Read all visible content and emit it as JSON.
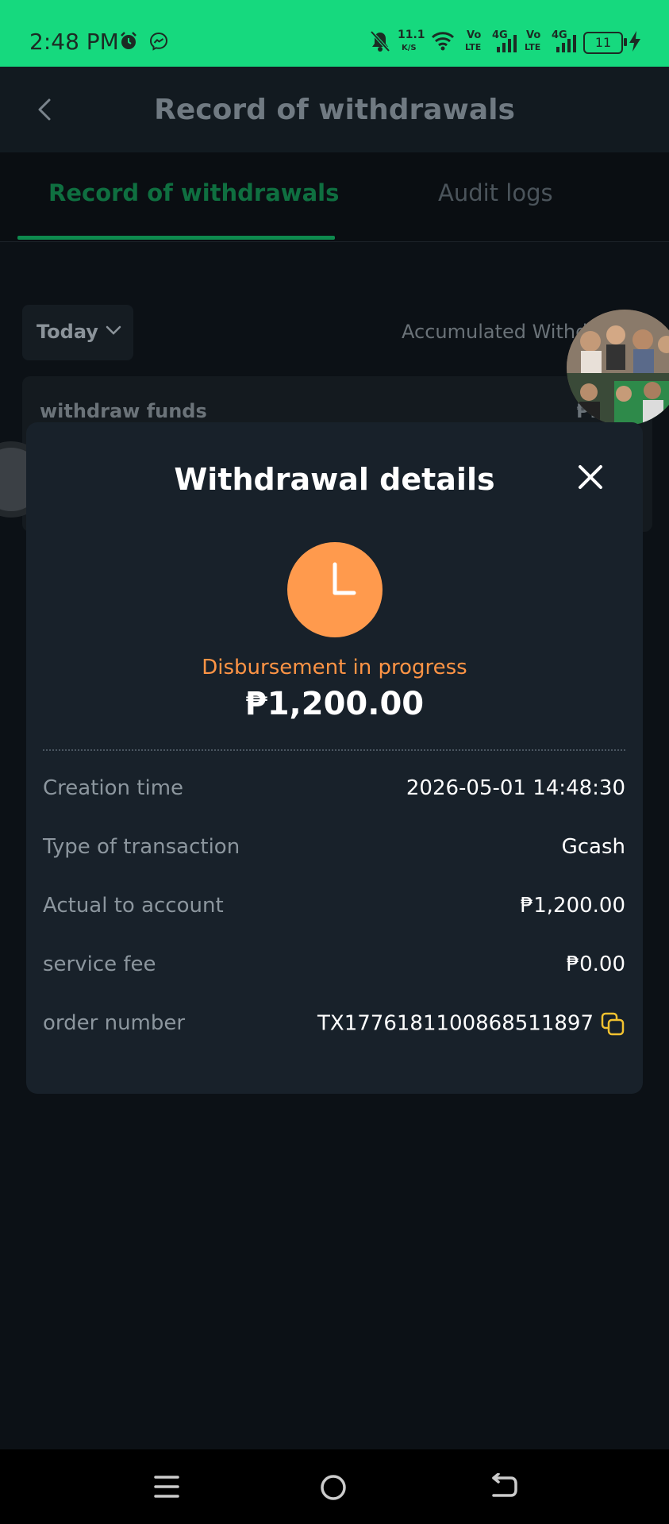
{
  "status_bar": {
    "time": "2:48 PM",
    "net_speed_value": "11.1",
    "net_speed_unit": "K/S",
    "sim1_top": "Vo",
    "sim1_bottom": "LTE",
    "sim1_net": "4G",
    "sim2_top": "Vo",
    "sim2_bottom": "LTE",
    "sim2_net": "4G",
    "battery": "11",
    "icons": [
      "alarm-icon",
      "messenger-icon",
      "mute-icon",
      "wifi-icon",
      "signal-icon",
      "battery-icon",
      "charging-icon"
    ]
  },
  "header": {
    "title": "Record of withdrawals"
  },
  "tabs": [
    {
      "label": "Record of withdrawals",
      "active": true
    },
    {
      "label": "Audit logs",
      "active": false
    }
  ],
  "filter": {
    "period": "Today",
    "accumulated_label": "Accumulated Withd"
  },
  "list": {
    "item_label": "withdraw funds",
    "item_amount": "₱1,20"
  },
  "modal": {
    "title": "Withdrawal details",
    "status": "Disbursement in progress",
    "amount": "₱1,200.00",
    "rows": [
      {
        "label": "Creation time",
        "value": "2026-05-01 14:48:30"
      },
      {
        "label": "Type of transaction",
        "value": "Gcash"
      },
      {
        "label": "Actual to account",
        "value": "₱1,200.00"
      },
      {
        "label": "service fee",
        "value": "₱0.00"
      },
      {
        "label": "order number",
        "value": "TX1776181100868511897"
      }
    ]
  },
  "colors": {
    "status_bar": "#16d97e",
    "accent": "#0e8a4e",
    "pending": "#ff9a4d",
    "modal_bg": "#18212a",
    "copy_icon": "#f2c230"
  }
}
